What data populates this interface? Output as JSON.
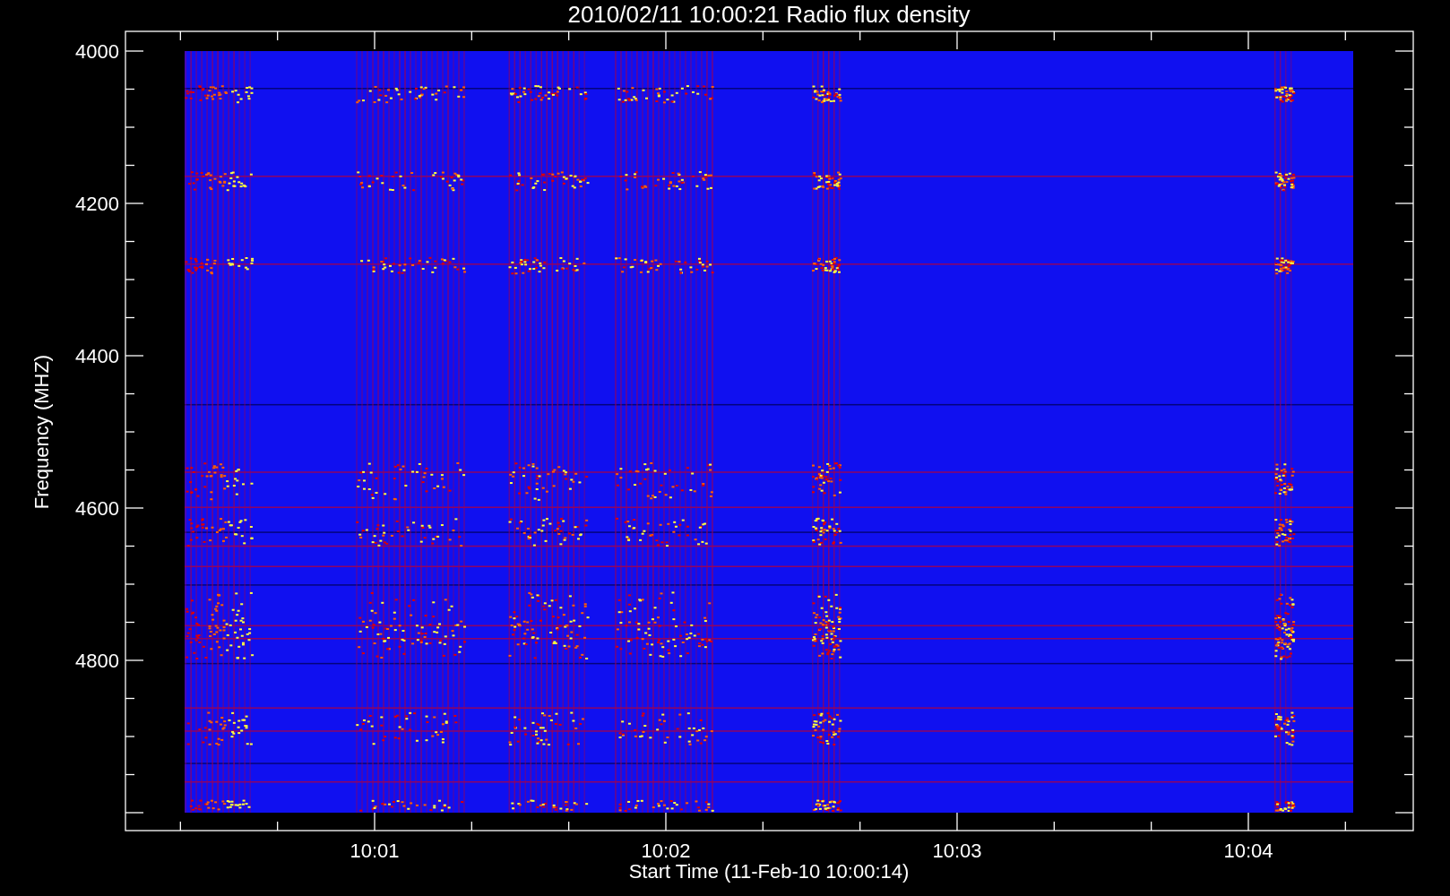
{
  "title": "2010/02/11 10:00:21 Radio flux density",
  "y_axis": {
    "label": "Frequency (MHZ)",
    "ticks": [
      "4000",
      "4200",
      "4400",
      "4600",
      "4800"
    ]
  },
  "x_axis": {
    "label": "Start Time (11-Feb-10 10:00:14)",
    "ticks": [
      "10:01",
      "10:02",
      "10:03",
      "10:04"
    ]
  }
}
